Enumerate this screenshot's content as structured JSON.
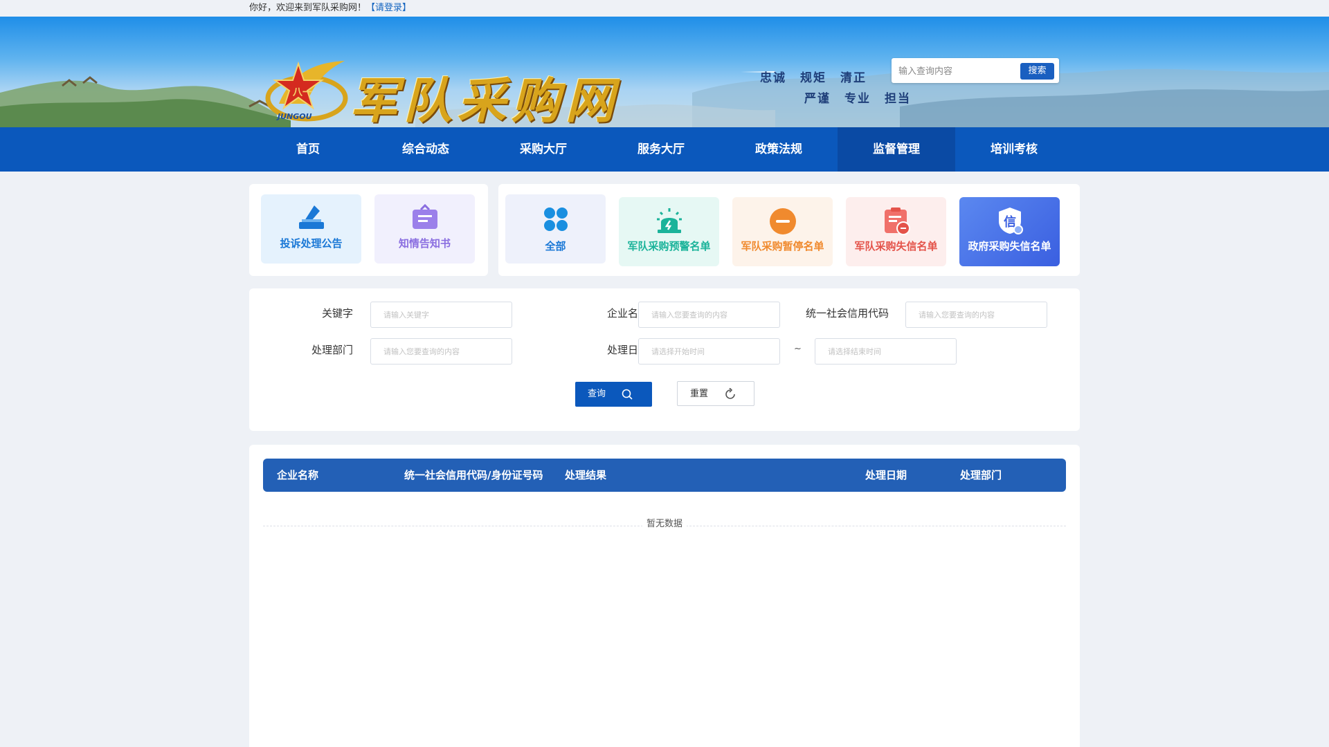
{
  "topbar": {
    "greeting": "你好，欢迎来到军队采购网！",
    "login_link": "【请登录】"
  },
  "header": {
    "site_title": "军队采购网",
    "emblem_text": "JUNGOU",
    "motto_row1": [
      "忠诚",
      "规矩",
      "清正"
    ],
    "motto_row2": [
      "严谨",
      "专业",
      "担当"
    ],
    "search": {
      "placeholder": "输入查询内容",
      "button": "搜索"
    }
  },
  "nav": {
    "items": [
      "首页",
      "综合动态",
      "采购大厅",
      "服务大厅",
      "政策法规",
      "监督管理",
      "培训考核"
    ],
    "active": "监督管理"
  },
  "categories_left": [
    {
      "label": "投诉处理公告",
      "icon": "ballot-box-icon",
      "color": "#1a78d6"
    },
    {
      "label": "知情告知书",
      "icon": "notice-board-icon",
      "color": "#8a6ee0"
    }
  ],
  "categories_right": [
    {
      "label": "全部",
      "icon": "grid-icon",
      "color": "#1a78d6"
    },
    {
      "label": "军队采购预警名单",
      "icon": "alarm-light-icon",
      "color": "#1bb39a"
    },
    {
      "label": "军队采购暂停名单",
      "icon": "pause-circle-icon",
      "color": "#f08a2e"
    },
    {
      "label": "军队采购失信名单",
      "icon": "clipboard-broken-icon",
      "color": "#e4534a"
    },
    {
      "label": "政府采购失信名单",
      "icon": "credit-shield-icon",
      "color": "#ffffff"
    }
  ],
  "form": {
    "keyword": {
      "label": "关键字",
      "placeholder": "请输入关键字"
    },
    "company": {
      "label": "企业名称",
      "placeholder": "请输入您要查询的内容"
    },
    "credit_code": {
      "label": "统一社会信用代码",
      "placeholder": "请输入您要查询的内容"
    },
    "department": {
      "label": "处理部门",
      "placeholder": "请输入您要查询的内容"
    },
    "date": {
      "label": "处理日期",
      "start_placeholder": "请选择开始时间",
      "end_placeholder": "请选择结束时间",
      "separator": "~"
    },
    "query_button": "查询",
    "reset_button": "重置"
  },
  "table": {
    "columns": [
      "企业名称",
      "统一社会信用代码/身份证号码",
      "处理结果",
      "处理日期",
      "处理部门"
    ],
    "empty_text": "暂无数据"
  },
  "colors": {
    "nav_bg": "#0b58bc",
    "nav_active": "#0a4aa4",
    "table_header": "#2360b6",
    "primary_button": "#0b58bc"
  }
}
